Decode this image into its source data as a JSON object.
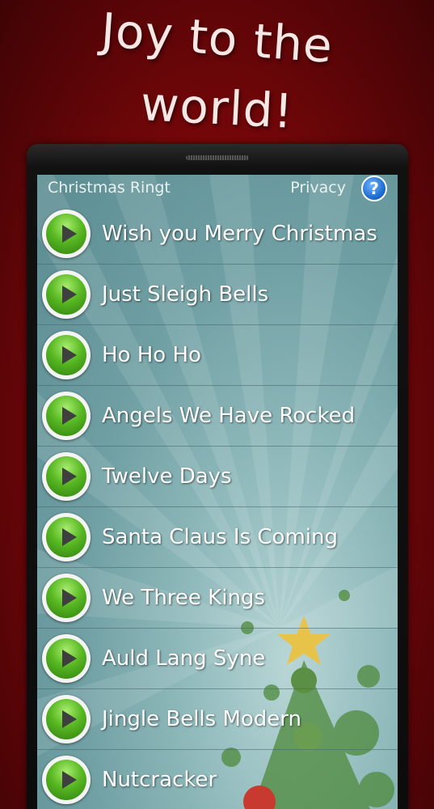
{
  "banner": {
    "line1": "Joy to the",
    "line2": "world!"
  },
  "header": {
    "app_title": "Christmas Ringt",
    "privacy_label": "Privacy",
    "help_symbol": "?"
  },
  "songs": [
    {
      "title": "Wish you Merry Christmas"
    },
    {
      "title": "Just Sleigh Bells"
    },
    {
      "title": "Ho Ho Ho"
    },
    {
      "title": "Angels We Have Rocked"
    },
    {
      "title": "Twelve Days"
    },
    {
      "title": "Santa Claus Is Coming"
    },
    {
      "title": "We Three Kings"
    },
    {
      "title": "Auld Lang Syne"
    },
    {
      "title": "Jingle Bells Modern"
    },
    {
      "title": "Nutcracker"
    }
  ],
  "icons": {
    "play": "play-icon",
    "help": "help-icon"
  },
  "colors": {
    "background": "#8a0a0d",
    "screen": "#7fa9ad",
    "play_green": "#58b822",
    "help_blue": "#1f6fd1"
  }
}
